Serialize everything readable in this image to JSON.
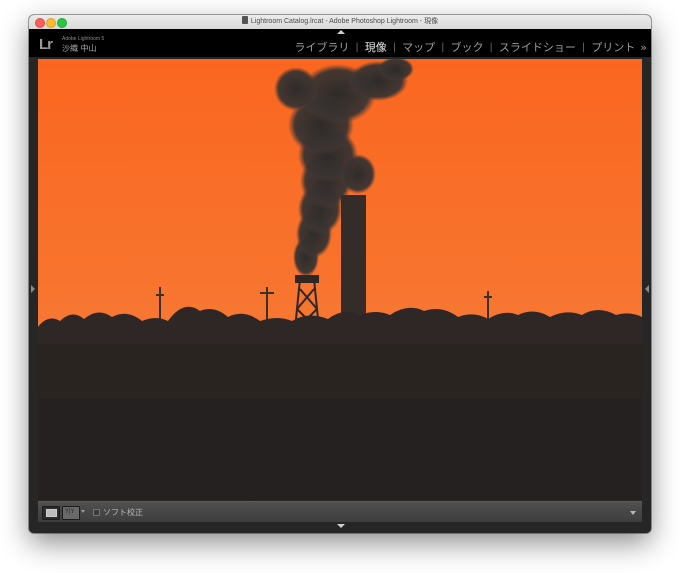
{
  "window": {
    "title": "Lightroom Catalog.lrcat - Adobe Photoshop Lightroom - 現像"
  },
  "identity": {
    "logo": "Lr",
    "app_name": "Adobe Lightroom 5",
    "user_name": "沙織 中山"
  },
  "modules": [
    {
      "label": "ライブラリ",
      "active": false
    },
    {
      "label": "現像",
      "active": true
    },
    {
      "label": "マップ",
      "active": false
    },
    {
      "label": "ブック",
      "active": false
    },
    {
      "label": "スライドショー",
      "active": false
    },
    {
      "label": "プリント",
      "active": false
    }
  ],
  "module_separator": "|",
  "module_more": "»",
  "toolbar": {
    "softproof_label": "ソフト校正",
    "softproof_checked": false
  },
  "icons": {
    "panel_top": "triangle-up-icon",
    "panel_bottom": "triangle-up-icon",
    "panel_left": "triangle-right-icon",
    "panel_right": "triangle-left-icon",
    "document": "document-icon"
  },
  "colors": {
    "sky_top": "#f96722",
    "sky_horizon": "#f47a3a",
    "silhouette": "#2b2422",
    "active_module": "#e6e6e6",
    "inactive_module": "#9c9c9c"
  }
}
